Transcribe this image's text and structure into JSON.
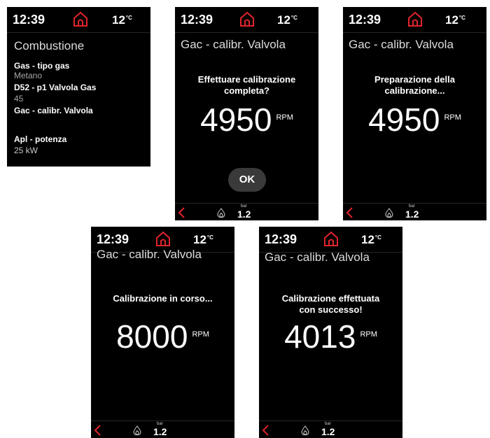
{
  "status": {
    "time": "12:39",
    "temp": "12",
    "temp_unit": "°C"
  },
  "footer": {
    "bar_label": "bar",
    "pressure": "1.2"
  },
  "menu": {
    "title": "Combustione",
    "items": [
      {
        "label": "Gas - tipo gas",
        "value": "Metano"
      },
      {
        "label": "D52 - p1 Valvola Gas",
        "value": "45"
      },
      {
        "label": "Gac - calibr. Valvola",
        "value": ""
      },
      {
        "label": "Apl - potenza",
        "value": "25 kW"
      }
    ]
  },
  "screens": [
    {
      "title": "Gac - calibr. Valvola",
      "message": [
        "Effettuare calibrazione",
        "completa?"
      ],
      "rpm": "4950",
      "rpm_unit": "RPM",
      "ok_label": "OK"
    },
    {
      "title": "Gac - calibr. Valvola",
      "message": [
        "Preparazione della",
        "calibrazione..."
      ],
      "rpm": "4950",
      "rpm_unit": "RPM"
    },
    {
      "title": "Gac - calibr. Valvola",
      "message": [
        "Calibrazione in corso..."
      ],
      "rpm": "8000",
      "rpm_unit": "RPM"
    },
    {
      "title": "Gac - calibr. Valvola",
      "message": [
        "Calibrazione effettuata",
        "con successo!"
      ],
      "rpm": "4013",
      "rpm_unit": "RPM"
    }
  ],
  "colors": {
    "accent": "#e0242b",
    "background": "#000000"
  },
  "icons": {
    "home": "home-icon",
    "back": "back-arrow-icon",
    "flame": "flame-icon"
  }
}
